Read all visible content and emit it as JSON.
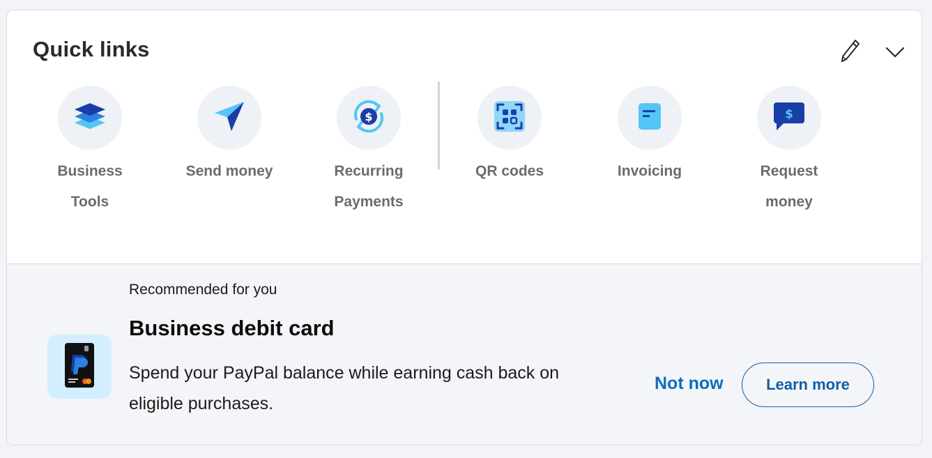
{
  "header": {
    "title": "Quick links"
  },
  "icons": {
    "edit": "pencil-icon",
    "collapse": "chevron-down-icon"
  },
  "quick_links": [
    {
      "label": "Business Tools",
      "icon": "layers-icon"
    },
    {
      "label": "Send money",
      "icon": "paper-plane-icon"
    },
    {
      "label": "Recurring Payments",
      "icon": "recurring-dollar-icon"
    },
    {
      "label": "QR codes",
      "icon": "qr-code-icon"
    },
    {
      "label": "Invoicing",
      "icon": "invoice-icon"
    },
    {
      "label": "Request money",
      "icon": "chat-dollar-icon"
    }
  ],
  "recommendation": {
    "eyebrow": "Recommended for you",
    "title": "Business debit card",
    "body": "Spend your PayPal balance while earning cash back on eligible purchases.",
    "image_icon": "paypal-debit-card-icon",
    "dismiss_label": "Not now",
    "cta_label": "Learn more"
  },
  "colors": {
    "accent_blue": "#0f6cbd",
    "icon_dark_blue": "#1a3ea8",
    "icon_light_blue": "#53c6f5",
    "circle_bg": "#eef1f6",
    "reco_bg": "#f4f5f8"
  }
}
